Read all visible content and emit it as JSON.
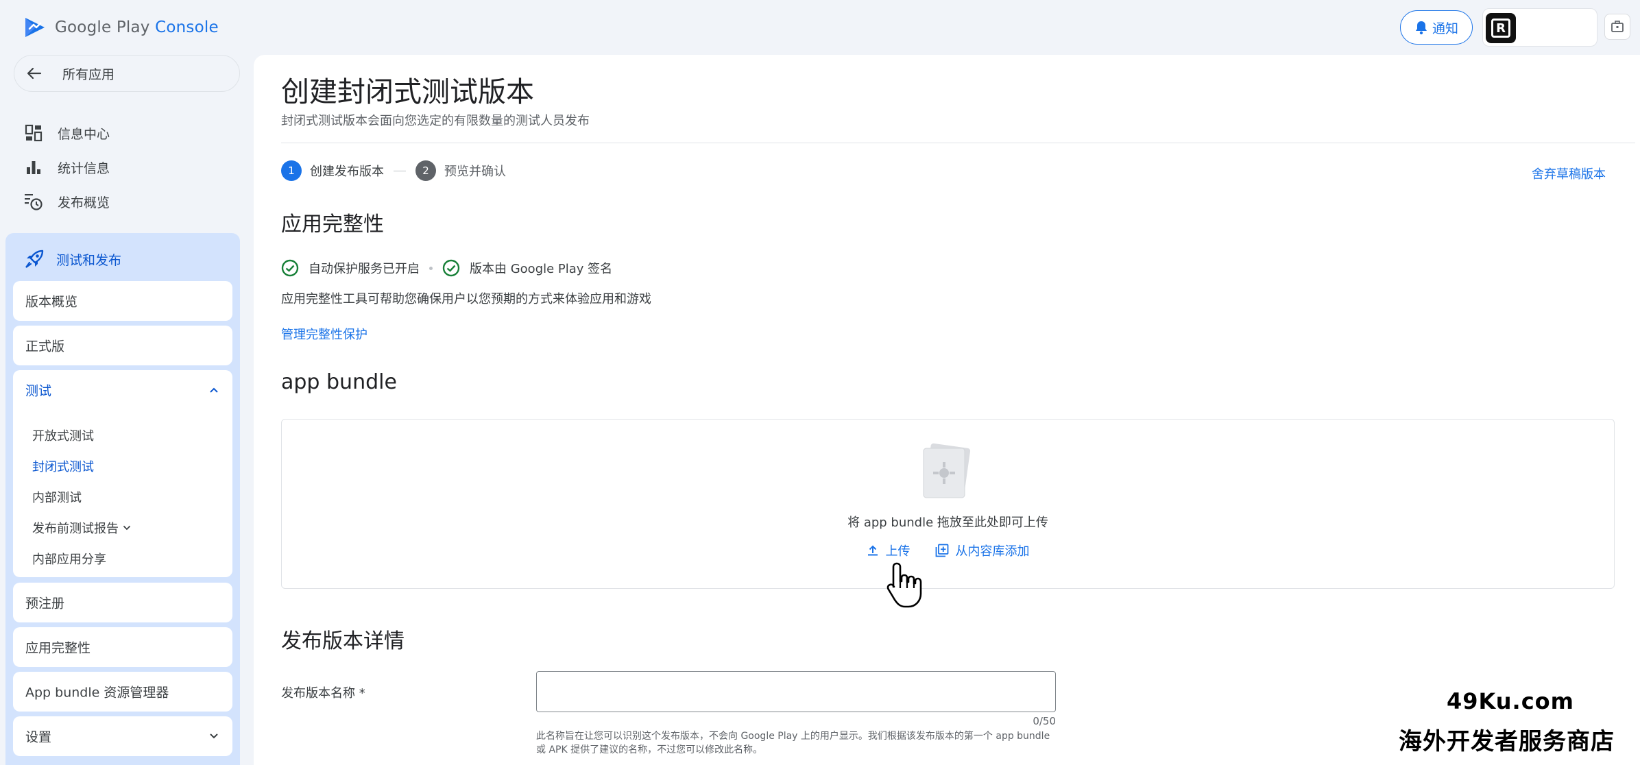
{
  "header": {
    "logo_google_play": "Google Play",
    "logo_console": "Console",
    "notify_label": "通知"
  },
  "sidebar": {
    "back_label": "所有应用",
    "top_items": [
      {
        "label": "信息中心",
        "icon": "dashboard-icon"
      },
      {
        "label": "统计信息",
        "icon": "bar-chart-icon"
      },
      {
        "label": "发布概览",
        "icon": "release-history-icon"
      }
    ],
    "section_title": "测试和发布",
    "cards": {
      "release_overview": "版本概览",
      "production": "正式版",
      "testing": "测试",
      "preregistration": "预注册",
      "app_integrity": "应用完整性",
      "bundle_explorer": "App bundle 资源管理器",
      "settings": "设置"
    },
    "testing_sub": [
      {
        "label": "开放式测试",
        "active": false
      },
      {
        "label": "封闭式测试",
        "active": true
      },
      {
        "label": "内部测试",
        "active": false
      },
      {
        "label": "发布前测试报告",
        "active": false
      },
      {
        "label": "内部应用分享",
        "active": false
      }
    ]
  },
  "main": {
    "title": "创建封闭式测试版本",
    "subtitle": "封闭式测试版本会面向您选定的有限数量的测试人员发布",
    "steps": [
      {
        "num": "1",
        "label": "创建发布版本"
      },
      {
        "num": "2",
        "label": "预览并确认"
      }
    ],
    "discard_label": "舍弃草稿版本",
    "integrity": {
      "heading": "应用完整性",
      "status_1": "自动保护服务已开启",
      "status_2": "版本由 Google Play 签名",
      "description": "应用完整性工具可帮助您确保用户以您预期的方式来体验应用和游戏",
      "manage_link": "管理完整性保护"
    },
    "bundle": {
      "heading": "app bundle",
      "drop_text": "将 app bundle 拖放至此处即可上传",
      "upload_label": "上传",
      "library_label": "从内容库添加"
    },
    "details": {
      "heading": "发布版本详情",
      "name_label": "发布版本名称 *",
      "name_value": "",
      "counter": "0/50",
      "helper": "此名称旨在让您可以识别这个发布版本，不会向 Google Play 上的用户显示。我们根据该发布版本的第一个 app bundle 或 APK 提供了建议的名称，不过您可以修改此名称。"
    }
  },
  "watermark": {
    "line1": "49Ku.com",
    "line2": "海外开发者服务商店"
  },
  "colors": {
    "accent": "#1a73e8",
    "active_section_bg": "#d3e3fd",
    "success": "#188038"
  }
}
